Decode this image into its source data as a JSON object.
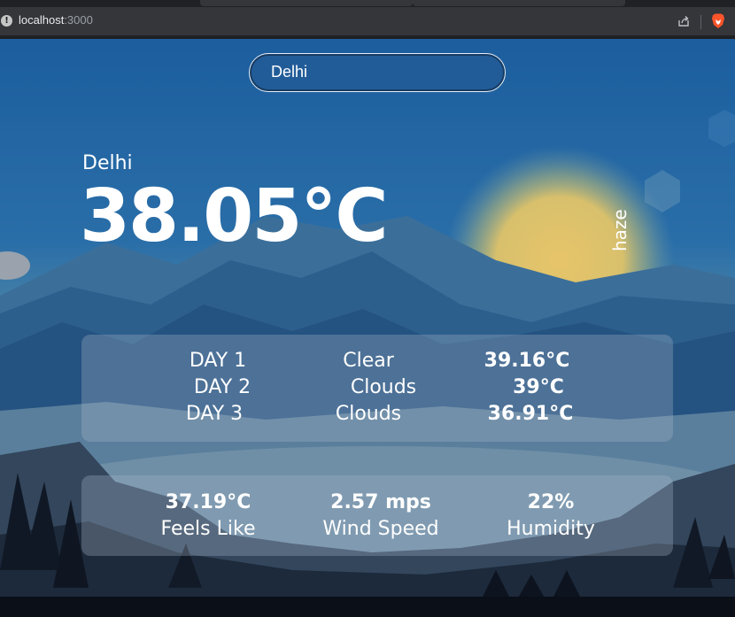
{
  "browser": {
    "url_host": "localhost",
    "url_port": ":3000",
    "info_icon": "!"
  },
  "search": {
    "value": "Delhi"
  },
  "current": {
    "city": "Delhi",
    "temperature": "38.05°C",
    "condition": "haze"
  },
  "forecast": [
    {
      "day": "DAY 1",
      "condition": "Clear",
      "temp": "39.16°C"
    },
    {
      "day": "DAY 2",
      "condition": "Clouds",
      "temp": "39°C"
    },
    {
      "day": "DAY 3",
      "condition": "Clouds",
      "temp": "36.91°C"
    }
  ],
  "stats": {
    "feels_like": {
      "value": "37.19°C",
      "label": "Feels Like"
    },
    "wind_speed": {
      "value": "2.57 mps",
      "label": "Wind Speed"
    },
    "humidity": {
      "value": "22%",
      "label": "Humidity"
    }
  },
  "icons": {
    "info": "info-icon",
    "share": "share-icon",
    "brave": "brave-lion-icon"
  },
  "colors": {
    "chrome_bg": "#35363a",
    "panel_bg": "rgba(165,180,200,0.32)",
    "brave_orange": "#fb542b",
    "sun": "#e7c56a"
  }
}
